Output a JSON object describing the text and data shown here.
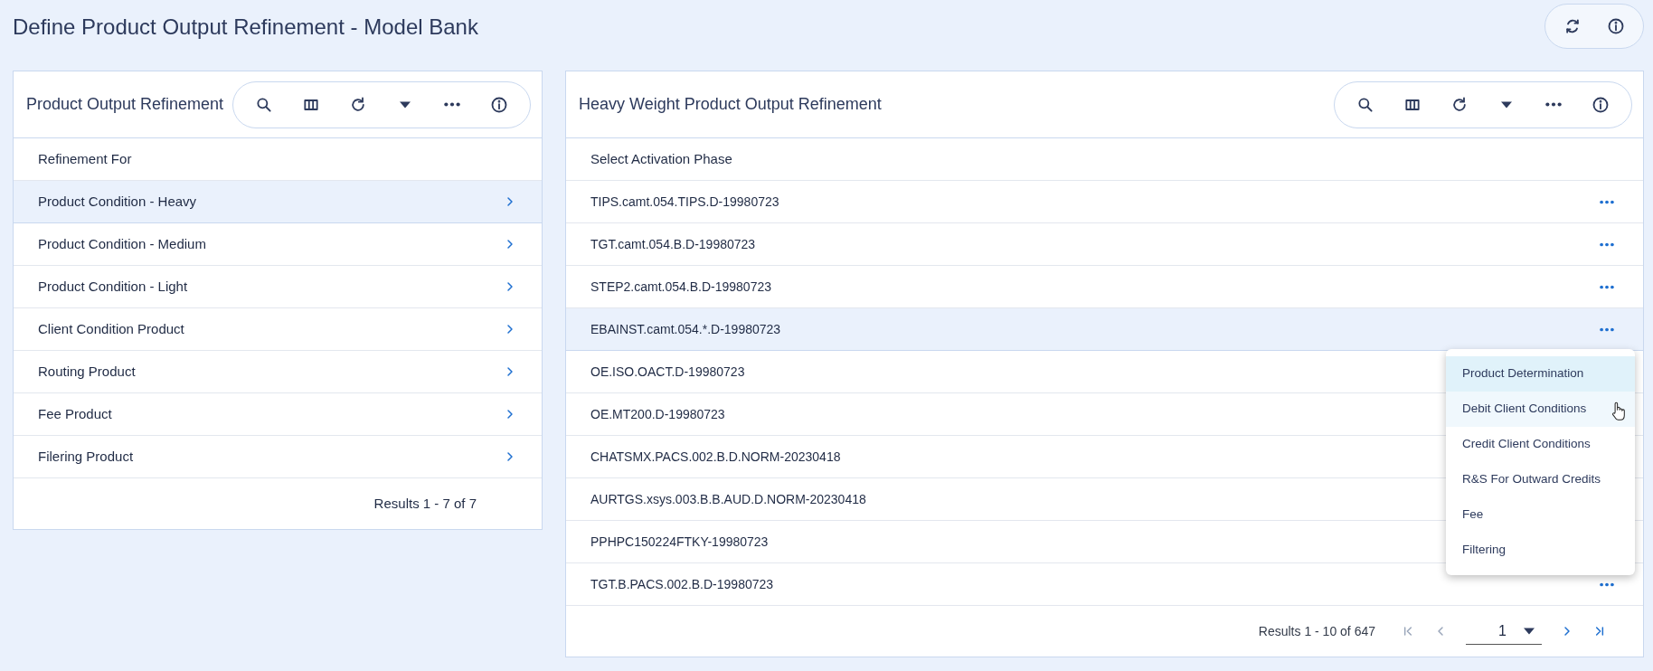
{
  "page": {
    "title": "Define Product Output Refinement - Model Bank"
  },
  "left_panel": {
    "title": "Product Output Refinement",
    "column": "Refinement For",
    "rows": [
      {
        "label": "Product Condition - Heavy",
        "selected": true
      },
      {
        "label": "Product Condition - Medium",
        "selected": false
      },
      {
        "label": "Product Condition - Light",
        "selected": false
      },
      {
        "label": "Client Condition Product",
        "selected": false
      },
      {
        "label": "Routing Product",
        "selected": false
      },
      {
        "label": "Fee Product",
        "selected": false
      },
      {
        "label": "Filering Product",
        "selected": false
      }
    ],
    "results": "Results 1 - 7 of 7"
  },
  "right_panel": {
    "title": "Heavy Weight Product Output Refinement",
    "column": "Select Activation Phase",
    "rows": [
      {
        "label": "TIPS.camt.054.TIPS.D-19980723",
        "selected": false
      },
      {
        "label": "TGT.camt.054.B.D-19980723",
        "selected": false
      },
      {
        "label": "STEP2.camt.054.B.D-19980723",
        "selected": false
      },
      {
        "label": "EBAINST.camt.054.*.D-19980723",
        "selected": true
      },
      {
        "label": "OE.ISO.OACT.D-19980723",
        "selected": false
      },
      {
        "label": "OE.MT200.D-19980723",
        "selected": false
      },
      {
        "label": "CHATSMX.PACS.002.B.D.NORM-20230418",
        "selected": false
      },
      {
        "label": "AURTGS.xsys.003.B.B.AUD.D.NORM-20230418",
        "selected": false
      },
      {
        "label": "PPHPC150224FTKY-19980723",
        "selected": false
      },
      {
        "label": "TGT.B.PACS.002.B.D-19980723",
        "selected": false
      }
    ],
    "results": "Results 1 - 10 of 647",
    "page": "1",
    "context_menu": [
      {
        "label": "Product Determination",
        "selected": true,
        "hovered": false
      },
      {
        "label": "Debit Client Conditions",
        "selected": false,
        "hovered": true
      },
      {
        "label": "Credit Client Conditions",
        "selected": false,
        "hovered": false
      },
      {
        "label": "R&S For Outward Credits",
        "selected": false,
        "hovered": false
      },
      {
        "label": "Fee",
        "selected": false,
        "hovered": false
      },
      {
        "label": "Filtering",
        "selected": false,
        "hovered": false
      }
    ]
  }
}
